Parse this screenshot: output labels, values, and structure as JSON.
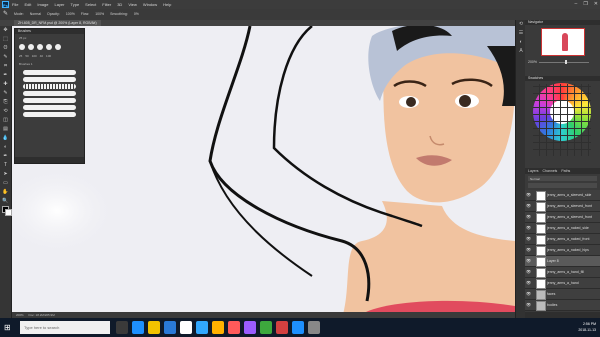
{
  "app": {
    "logo": "Ps",
    "menus": [
      "File",
      "Edit",
      "Image",
      "Layer",
      "Type",
      "Select",
      "Filter",
      "3D",
      "View",
      "Window",
      "Help"
    ],
    "window_controls": [
      "–",
      "❐",
      "✕"
    ]
  },
  "options_bar": {
    "items": [
      "Mode:",
      "Normal",
      "Opacity:",
      "100%",
      "Flow:",
      "100%",
      "Smoothing:",
      "0%"
    ]
  },
  "document_tab": {
    "title": "ZH-605_DR_NFM.psd @ 200% (Layer 8, RGB/8#)"
  },
  "toolbar": {
    "tools": [
      "move-tool-icon",
      "marquee-tool-icon",
      "lasso-tool-icon",
      "quick-select-icon",
      "crop-tool-icon",
      "eyedropper-icon",
      "heal-brush-icon",
      "brush-tool-icon",
      "stamp-tool-icon",
      "history-brush-icon",
      "eraser-tool-icon",
      "gradient-tool-icon",
      "blur-tool-icon",
      "dodge-tool-icon",
      "pen-tool-icon",
      "type-tool-icon",
      "path-select-icon",
      "shape-tool-icon",
      "hand-tool-icon",
      "zoom-tool-icon"
    ],
    "glyphs": [
      "✥",
      "⬚",
      "ʘ",
      "✎",
      "⌗",
      "✒",
      "✚",
      "✎",
      "⎘",
      "⟲",
      "◫",
      "▤",
      "💧",
      "◐",
      "✒",
      "T",
      "➤",
      "▭",
      "✋",
      "🔍"
    ]
  },
  "brush_panel": {
    "title": "Brushes",
    "size_value": "25 px",
    "preset_labels": [
      "25",
      "50",
      "100",
      "40",
      "100"
    ],
    "group_label": "Brushes 1"
  },
  "navigator": {
    "title": "Navigator",
    "zoom": "200%"
  },
  "swatches": {
    "title": "Swatches"
  },
  "layers_panel": {
    "tabs": [
      "Layers",
      "Channels",
      "Paths"
    ],
    "blend_mode": "Normal",
    "layers": [
      {
        "name": "jenny_arms_a_sleeved_side",
        "kind": "layer",
        "selected": false
      },
      {
        "name": "jenny_arms_a_sleeved_front",
        "kind": "layer",
        "selected": false
      },
      {
        "name": "jenny_arms_a_sleeved_front",
        "kind": "layer",
        "selected": false
      },
      {
        "name": "jenny_arms_a_naked_side",
        "kind": "layer",
        "selected": false
      },
      {
        "name": "jenny_arms_a_naked_front",
        "kind": "layer",
        "selected": false
      },
      {
        "name": "jenny_arms_a_naked_hips",
        "kind": "layer",
        "selected": false
      },
      {
        "name": "Layer 8",
        "kind": "layer",
        "selected": true
      },
      {
        "name": "jenny_arms_a_hand_fill",
        "kind": "layer",
        "selected": false
      },
      {
        "name": "jenny_arms_a_hand",
        "kind": "layer",
        "selected": false
      },
      {
        "name": "faces",
        "kind": "folder",
        "selected": false
      },
      {
        "name": "bodies",
        "kind": "folder",
        "selected": false
      }
    ]
  },
  "status_bar": {
    "zoom": "200%",
    "doc_size": "Doc: 18.2M/205.9M"
  },
  "taskbar": {
    "search_placeholder": "Type here to search",
    "time": "2:56 PM",
    "date": "2018-11-13",
    "app_colors": [
      "#3a3a3a",
      "#1e90ff",
      "#f2c200",
      "#2a7ad8",
      "#ffffff",
      "#31a8ff",
      "#ffb100",
      "#ff5a5a",
      "#9b5cff",
      "#3da83d",
      "#d34040",
      "#1e90ff",
      "#888888"
    ]
  },
  "colors": {
    "canvas_bg": "#eeeef3",
    "ps_blue": "#31a8ff",
    "skin": "#f1c3a0",
    "top_red": "#e14b5e"
  }
}
